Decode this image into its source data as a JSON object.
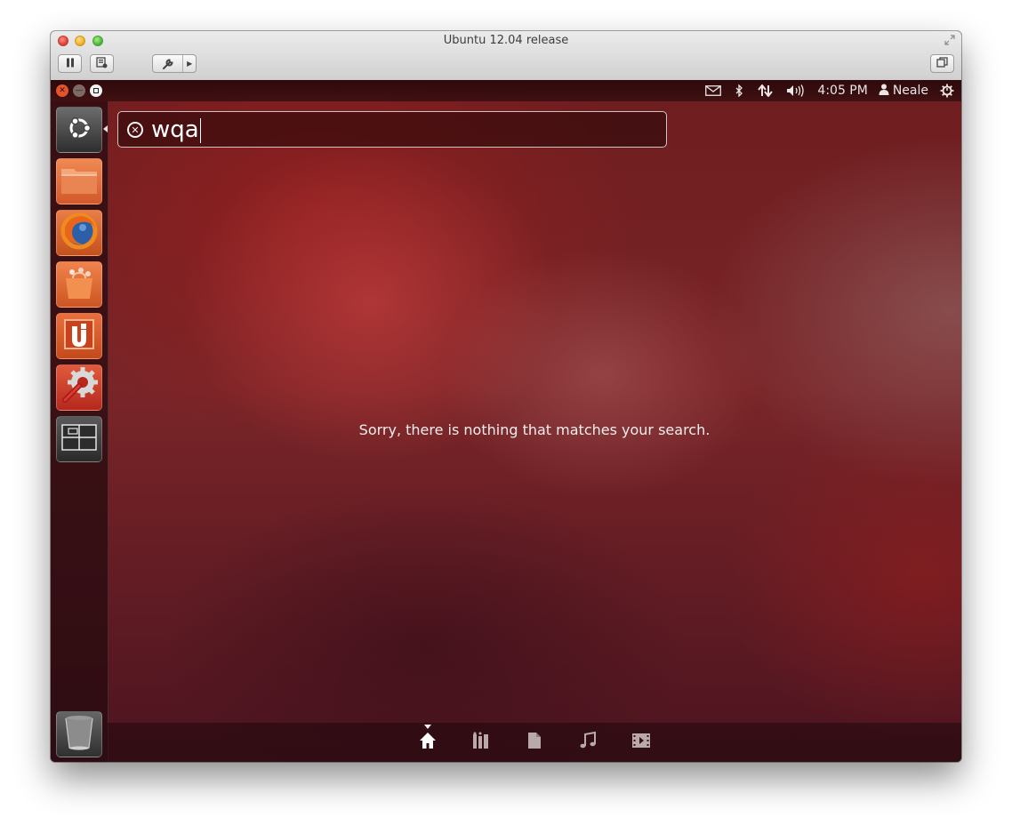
{
  "host_window": {
    "title": "Ubuntu 12.04 release",
    "toolbar": {
      "pause_icon": "pause-icon",
      "snapshot_icon": "snapshot-icon",
      "settings_icon": "wrench-icon",
      "settings_menu_icon": "triangle-right-icon",
      "window_mode_icon": "window-stack-icon",
      "fullscreen_icon": "fullscreen-arrows-icon"
    }
  },
  "panel": {
    "indicators": {
      "mail_icon": "envelope-icon",
      "bluetooth_icon": "bluetooth-icon",
      "network_icon": "network-arrows-icon",
      "volume_icon": "speaker-icon",
      "clock": "4:05 PM",
      "user_icon": "person-icon",
      "user": "Neale",
      "session_icon": "power-gear-icon"
    }
  },
  "launcher": {
    "items": [
      {
        "name": "Dash Home",
        "icon": "ubuntu-logo-icon"
      },
      {
        "name": "Home Folder",
        "icon": "folder-icon"
      },
      {
        "name": "Firefox Web Browser",
        "icon": "firefox-icon"
      },
      {
        "name": "Ubuntu Software Centre",
        "icon": "shopping-bag-icon"
      },
      {
        "name": "Ubuntu One",
        "icon": "ubuntu-one-icon"
      },
      {
        "name": "System Settings",
        "icon": "settings-gear-wrench-icon"
      },
      {
        "name": "Workspace Switcher",
        "icon": "workspaces-icon"
      },
      {
        "name": "Trash",
        "icon": "trash-icon"
      }
    ]
  },
  "dash": {
    "search": {
      "query": "wqa",
      "clear_icon": "circle-x-icon"
    },
    "no_results_message": "Sorry, there is nothing that matches your search.",
    "lenses": [
      {
        "name": "home",
        "icon": "home-icon",
        "active": true
      },
      {
        "name": "applications",
        "icon": "applications-icon",
        "active": false
      },
      {
        "name": "files",
        "icon": "file-icon",
        "active": false
      },
      {
        "name": "music",
        "icon": "music-note-icon",
        "active": false
      },
      {
        "name": "video",
        "icon": "film-icon",
        "active": false
      }
    ]
  },
  "colors": {
    "ubuntu_orange": "#dd4814",
    "panel_text": "#ece6e6",
    "message_text": "#f5eded"
  }
}
